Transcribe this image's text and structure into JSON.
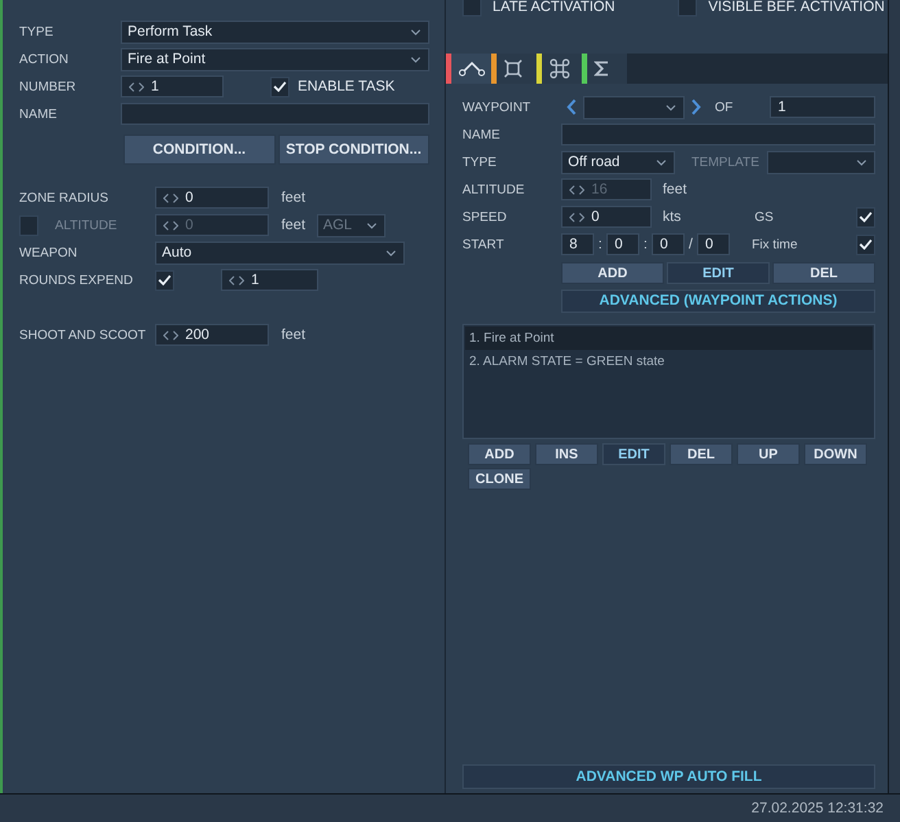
{
  "top_options": [
    {
      "label": "LATE ACTIVATION",
      "checked": false
    },
    {
      "label": "VISIBLE BEF. ACTIVATION",
      "checked": false
    }
  ],
  "task": {
    "type_label": "TYPE",
    "type": "Perform Task",
    "action_label": "ACTION",
    "action": "Fire at Point",
    "number_label": "NUMBER",
    "number": "1",
    "enable_task": {
      "label": "ENABLE TASK",
      "checked": true
    },
    "name_label": "NAME",
    "buttons": [
      "CONDITION...",
      "STOP CONDITION..."
    ]
  },
  "params": {
    "zone_radius": {
      "label": "ZONE RADIUS",
      "value": "0",
      "unit": "feet"
    },
    "altitude": {
      "label": "ALTITUDE",
      "checked": false,
      "value": "0",
      "unit": "feet",
      "reference": "AGL",
      "disabled": true
    },
    "weapon": {
      "label": "WEAPON",
      "value": "Auto"
    },
    "rounds_expend": {
      "label": "ROUNDS EXPEND",
      "checked": true,
      "value": "1"
    },
    "shoot_and_scoot": {
      "label": "SHOOT AND SCOOT",
      "value": "200",
      "unit": "feet"
    }
  },
  "tabs": [
    {
      "kind": "route",
      "color": "#e8555c",
      "selected": true
    },
    {
      "kind": "zone",
      "color": "#e8962e",
      "selected": false
    },
    {
      "kind": "command",
      "color": "#d8d43a",
      "selected": false
    },
    {
      "kind": "sum",
      "color": "#54c85a",
      "selected": false
    }
  ],
  "waypoint": {
    "label": "WAYPOINT",
    "of_label": "OF",
    "count": "1",
    "name_label": "NAME",
    "type_label": "TYPE",
    "type": "Off road",
    "template_label": "TEMPLATE",
    "altitude": {
      "label": "ALTITUDE",
      "value": "16",
      "unit": "feet",
      "disabled": true
    },
    "speed": {
      "label": "SPEED",
      "value": "0",
      "unit": "kts",
      "gs_label": "GS",
      "gs_checked": true
    },
    "start": {
      "label": "START",
      "hours": "8",
      "separators": [
        ":",
        ":",
        "/"
      ],
      "minutes": "0",
      "seconds": "0",
      "days": "0",
      "fix_time_label": "Fix time",
      "fix_time_checked": true
    },
    "buttons": [
      {
        "label": "ADD",
        "pressed": false
      },
      {
        "label": "EDIT",
        "pressed": true
      },
      {
        "label": "DEL",
        "pressed": false
      }
    ],
    "advanced_button": "ADVANCED (WAYPOINT ACTIONS)"
  },
  "actions": [
    {
      "label": "1. Fire at Point",
      "selected": true
    },
    {
      "label": "2. ALARM STATE = GREEN state",
      "selected": false
    }
  ],
  "action_buttons": [
    {
      "label": "ADD",
      "pressed": false
    },
    {
      "label": "INS",
      "pressed": false
    },
    {
      "label": "EDIT",
      "pressed": true
    },
    {
      "label": "DEL",
      "pressed": false
    },
    {
      "label": "UP",
      "pressed": false
    },
    {
      "label": "DOWN",
      "pressed": false
    },
    {
      "label": "CLONE",
      "pressed": false
    }
  ],
  "auto_fill_button": "ADVANCED WP AUTO FILL",
  "status_bar": {
    "datetime": "27.02.2025 12:31:32"
  }
}
